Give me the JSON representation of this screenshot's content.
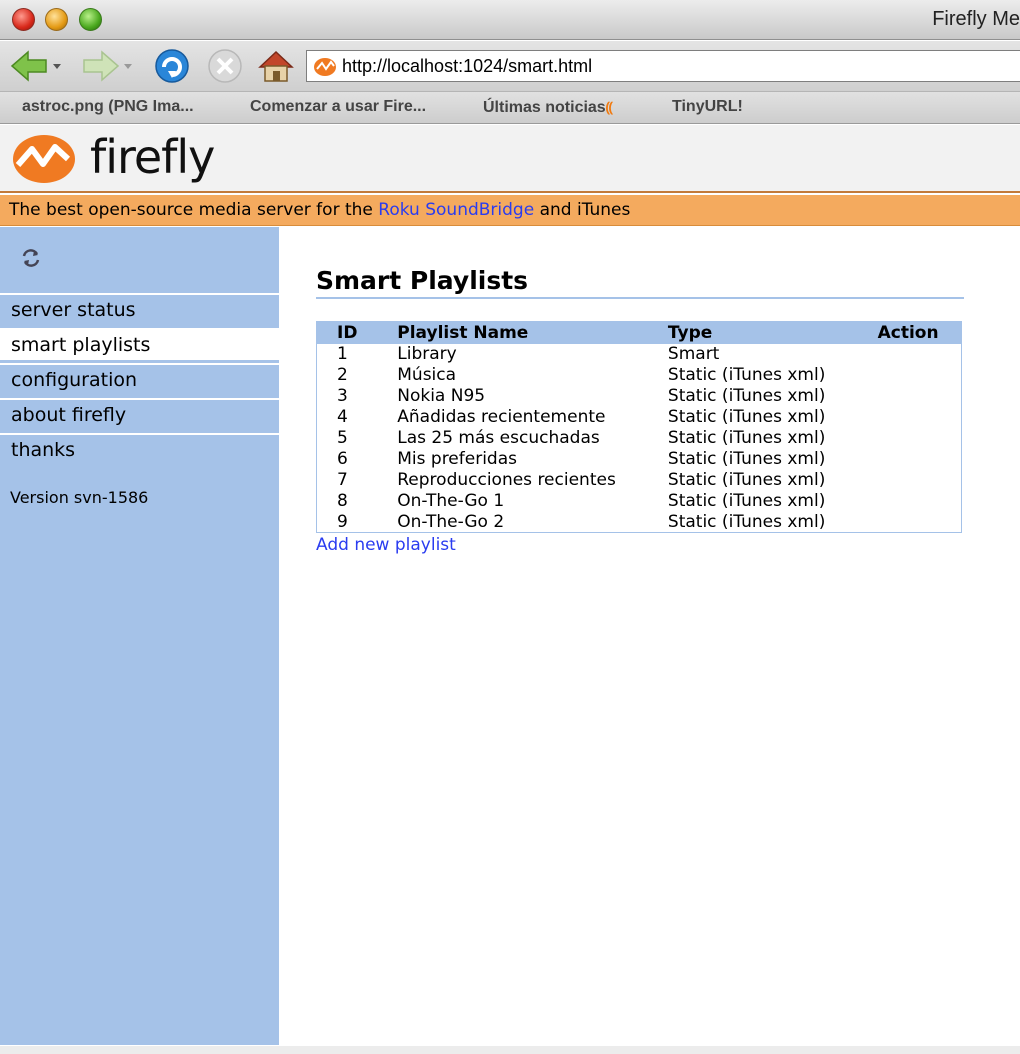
{
  "browser": {
    "window_title": "Firefly Me",
    "url": "http://localhost:1024/smart.html",
    "bookmarks": [
      {
        "label": "astroc.png (PNG Ima..."
      },
      {
        "label": "Comenzar a usar Fire..."
      },
      {
        "label": "Últimas noticias"
      },
      {
        "label": "TinyURL!"
      }
    ]
  },
  "header": {
    "logo_text": "firefly",
    "tagline_prefix": "The best open-source media server for the ",
    "tagline_link": "Roku SoundBridge",
    "tagline_suffix": " and iTunes"
  },
  "sidebar": {
    "items": [
      {
        "label": "server status",
        "active": false
      },
      {
        "label": "smart playlists",
        "active": true
      },
      {
        "label": "configuration",
        "active": false
      },
      {
        "label": "about firefly",
        "active": false
      },
      {
        "label": "thanks",
        "active": false
      }
    ],
    "version": "Version svn-1586"
  },
  "main": {
    "title": "Smart Playlists",
    "columns": {
      "id": "ID",
      "name": "Playlist Name",
      "type": "Type",
      "action": "Action"
    },
    "rows": [
      {
        "id": "1",
        "name": "Library",
        "type": "Smart"
      },
      {
        "id": "2",
        "name": "Música",
        "type": "Static (iTunes xml)"
      },
      {
        "id": "3",
        "name": "Nokia N95",
        "type": "Static (iTunes xml)"
      },
      {
        "id": "4",
        "name": "Añadidas recientemente",
        "type": "Static (iTunes xml)"
      },
      {
        "id": "5",
        "name": "Las 25 más escuchadas",
        "type": "Static (iTunes xml)"
      },
      {
        "id": "6",
        "name": "Mis preferidas",
        "type": "Static (iTunes xml)"
      },
      {
        "id": "7",
        "name": "Reproducciones recientes",
        "type": "Static (iTunes xml)"
      },
      {
        "id": "8",
        "name": "On-The-Go 1",
        "type": "Static (iTunes xml)"
      },
      {
        "id": "9",
        "name": "On-The-Go 2",
        "type": "Static (iTunes xml)"
      }
    ],
    "add_link": "Add new playlist"
  },
  "colors": {
    "sidebar": "#a5c2e8",
    "tagline": "#f4aa5e",
    "link": "#2a3cf0",
    "logo": "#f07a22"
  }
}
